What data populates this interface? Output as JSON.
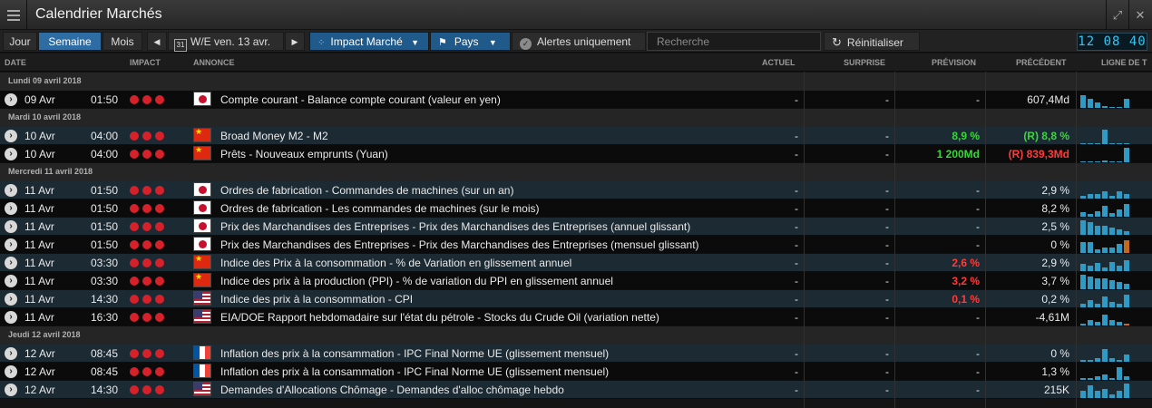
{
  "window": {
    "title": "Calendrier Marchés"
  },
  "toolbar": {
    "tab_day": "Jour",
    "tab_week": "Semaine",
    "tab_month": "Mois",
    "prev_label": "◀",
    "next_label": "▶",
    "calendar_day": "31",
    "week_label": "W/E ven. 13 avr.",
    "impact_label": "Impact Marché",
    "country_label": "Pays",
    "alerts_label": "Alertes uniquement",
    "search_placeholder": "Recherche",
    "reset_label": "Réinitialiser",
    "clock": "12 08 40"
  },
  "columns": {
    "date": "DATE",
    "impact": "IMPACT",
    "announcement": "ANNONCE",
    "actual": "ACTUEL",
    "surprise": "SURPRISE",
    "forecast": "PRÉVISION",
    "previous": "PRÉCÉDENT",
    "trend": "LIGNE DE T"
  },
  "groups": [
    {
      "label": "Lundi 09 avril 2018",
      "rows": [
        {
          "date": "09 Avr",
          "time": "01:50",
          "country": "jp",
          "announcement": "Compte courant - Balance compte courant (valeur en yen)",
          "actual": "-",
          "surprise": "-",
          "forecast": "-",
          "forecast_color": "",
          "previous": "607,4Md",
          "previous_color": "",
          "spark_heights": [
            14,
            10,
            6,
            2,
            0,
            0,
            10
          ],
          "spark_last_orange": false
        }
      ]
    },
    {
      "label": "Mardi 10 avril 2018",
      "rows": [
        {
          "date": "10 Avr",
          "time": "04:00",
          "country": "cn",
          "announcement": "Broad Money M2 - M2",
          "actual": "-",
          "surprise": "-",
          "forecast": "8,9 %",
          "forecast_color": "green",
          "previous": "(R) 8,8 %",
          "previous_color": "green",
          "spark_heights": [
            0,
            0,
            0,
            16,
            0,
            0,
            1
          ],
          "spark_last_orange": false
        },
        {
          "date": "10 Avr",
          "time": "04:00",
          "country": "cn",
          "announcement": "Prêts - Nouveaux emprunts (Yuan)",
          "actual": "-",
          "surprise": "-",
          "forecast": "1 200Md",
          "forecast_color": "green",
          "previous": "(R) 839,3Md",
          "previous_color": "red",
          "spark_heights": [
            0,
            0,
            0,
            2,
            0,
            0,
            16
          ],
          "spark_last_orange": false
        }
      ]
    },
    {
      "label": "Mercredi 11 avril 2018",
      "rows": [
        {
          "date": "11 Avr",
          "time": "01:50",
          "country": "jp",
          "announcement": "Ordres de fabrication - Commandes de machines (sur un an)",
          "actual": "-",
          "surprise": "-",
          "forecast": "-",
          "forecast_color": "",
          "previous": "2,9 %",
          "previous_color": "",
          "spark_heights": [
            3,
            5,
            5,
            8,
            3,
            8,
            5
          ],
          "spark_last_orange": false
        },
        {
          "date": "11 Avr",
          "time": "01:50",
          "country": "jp",
          "announcement": "Ordres de fabrication - Les commandes de machines (sur le mois)",
          "actual": "-",
          "surprise": "-",
          "forecast": "-",
          "forecast_color": "",
          "previous": "8,2 %",
          "previous_color": "",
          "spark_heights": [
            5,
            3,
            6,
            12,
            4,
            8,
            14
          ],
          "spark_last_orange": false
        },
        {
          "date": "11 Avr",
          "time": "01:50",
          "country": "jp",
          "announcement": "Prix des Marchandises des Entreprises - Prix des Marchandises des Entreprises (annuel glissant)",
          "actual": "-",
          "surprise": "-",
          "forecast": "-",
          "forecast_color": "",
          "previous": "2,5 %",
          "previous_color": "",
          "spark_heights": [
            16,
            14,
            10,
            10,
            8,
            6,
            4
          ],
          "spark_last_orange": false
        },
        {
          "date": "11 Avr",
          "time": "01:50",
          "country": "jp",
          "announcement": "Prix des Marchandises des Entreprises - Prix des Marchandises des Entreprises (mensuel glissant)",
          "actual": "-",
          "surprise": "-",
          "forecast": "-",
          "forecast_color": "",
          "previous": "0 %",
          "previous_color": "",
          "spark_heights": [
            12,
            12,
            4,
            6,
            6,
            10,
            14
          ],
          "spark_last_orange": true
        },
        {
          "date": "11 Avr",
          "time": "03:30",
          "country": "cn",
          "announcement": "Indice des Prix à la consommation - % de Variation en glissement annuel",
          "actual": "-",
          "surprise": "-",
          "forecast": "2,6 %",
          "forecast_color": "red",
          "previous": "2,9 %",
          "previous_color": "",
          "spark_heights": [
            8,
            6,
            9,
            4,
            10,
            6,
            12
          ],
          "spark_last_orange": false
        },
        {
          "date": "11 Avr",
          "time": "03:30",
          "country": "cn",
          "announcement": "Indice des prix à la production (PPI) - % de variation du PPI en glissement annuel",
          "actual": "-",
          "surprise": "-",
          "forecast": "3,2 %",
          "forecast_color": "red",
          "previous": "3,7 %",
          "previous_color": "",
          "spark_heights": [
            16,
            14,
            12,
            12,
            10,
            8,
            6
          ],
          "spark_last_orange": false
        },
        {
          "date": "11 Avr",
          "time": "14:30",
          "country": "us",
          "announcement": "Indice des prix à la consommation - CPI",
          "actual": "-",
          "surprise": "-",
          "forecast": "0,1 %",
          "forecast_color": "red",
          "previous": "0,2 %",
          "previous_color": "",
          "spark_heights": [
            4,
            8,
            4,
            12,
            6,
            4,
            14
          ],
          "spark_last_orange": false
        },
        {
          "date": "11 Avr",
          "time": "16:30",
          "country": "us",
          "announcement": "EIA/DOE Rapport hebdomadaire sur l'état du pétrole - Stocks du Crude Oil (variation nette)",
          "actual": "-",
          "surprise": "-",
          "forecast": "-",
          "forecast_color": "",
          "previous": "-4,61M",
          "previous_color": "",
          "spark_heights": [
            2,
            6,
            4,
            12,
            6,
            4,
            2
          ],
          "spark_last_orange": true
        }
      ]
    },
    {
      "label": "Jeudi 12 avril 2018",
      "rows": [
        {
          "date": "12 Avr",
          "time": "08:45",
          "country": "fr",
          "announcement": "Inflation des prix à la consammation - IPC Final Norme UE (glissement mensuel)",
          "actual": "-",
          "surprise": "-",
          "forecast": "-",
          "forecast_color": "",
          "previous": "0 %",
          "previous_color": "",
          "spark_heights": [
            2,
            2,
            4,
            14,
            4,
            2,
            8
          ],
          "spark_last_orange": false
        },
        {
          "date": "12 Avr",
          "time": "08:45",
          "country": "fr",
          "announcement": "Inflation des prix à la consammation - IPC Final Norme UE (glissement mensuel)",
          "actual": "-",
          "surprise": "-",
          "forecast": "-",
          "forecast_color": "",
          "previous": "1,3 %",
          "previous_color": "",
          "spark_heights": [
            2,
            2,
            4,
            6,
            2,
            14,
            4
          ],
          "spark_last_orange": false
        },
        {
          "date": "12 Avr",
          "time": "14:30",
          "country": "us",
          "announcement": "Demandes d'Allocations Chômage - Demandes d'alloc chômage hebdo",
          "actual": "-",
          "surprise": "-",
          "forecast": "-",
          "forecast_color": "",
          "previous": "215K",
          "previous_color": "",
          "spark_heights": [
            8,
            14,
            8,
            10,
            4,
            8,
            16
          ],
          "spark_last_orange": false
        }
      ]
    }
  ],
  "colors": {
    "accent": "#2e6da4",
    "impact_high": "#d6202a",
    "positive": "#3ad63a",
    "negative": "#ff3b3b",
    "spark": "#2f9bc4",
    "spark_alt": "#c06a1e"
  }
}
